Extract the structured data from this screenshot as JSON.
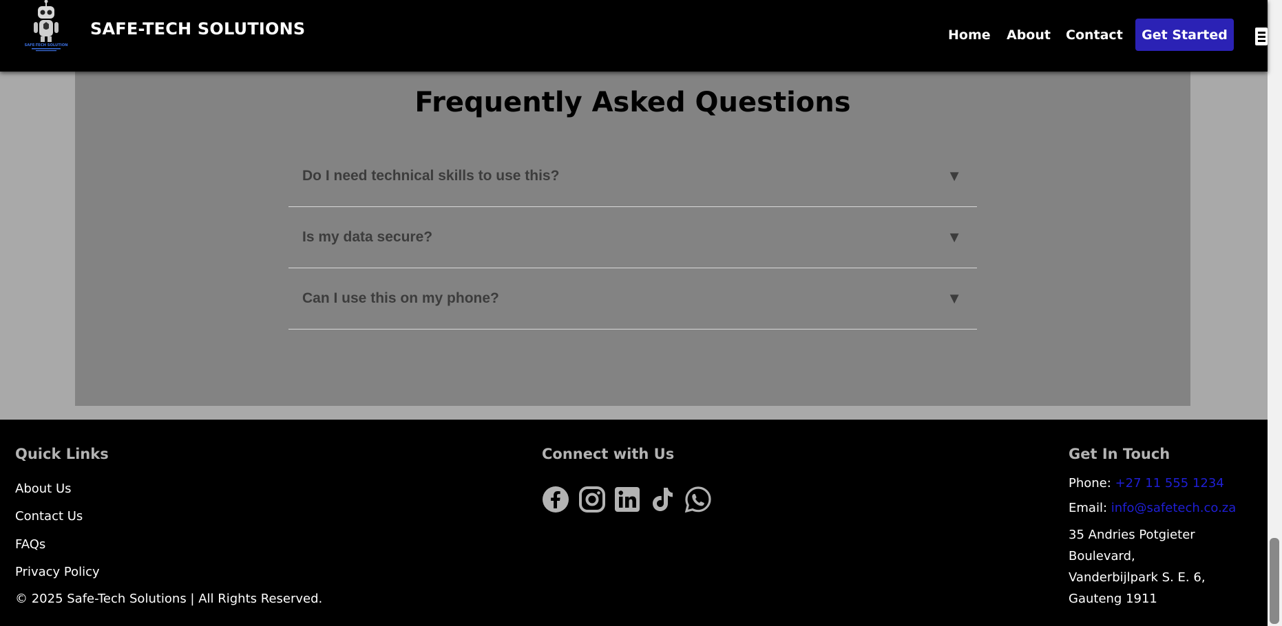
{
  "header": {
    "brand": "SAFE-TECH SOLUTIONS",
    "logo_text": "SAFE-TECH SOLUTION",
    "nav": {
      "home": "Home",
      "about": "About",
      "contact": "Contact"
    },
    "cta": "Get Started",
    "menu_icon": "hamburger-icon"
  },
  "faq": {
    "title": "Frequently Asked Questions",
    "items": [
      {
        "question": "Do I need technical skills to use this?",
        "arrow": "▼"
      },
      {
        "question": "Is my data secure?",
        "arrow": "▼"
      },
      {
        "question": "Can I use this on my phone?",
        "arrow": "▼"
      }
    ]
  },
  "footer": {
    "quick_links": {
      "heading": "Quick Links",
      "links": [
        "About Us",
        "Contact Us",
        "FAQs",
        "Privacy Policy"
      ]
    },
    "connect": {
      "heading": "Connect with Us",
      "icons": [
        "facebook-icon",
        "instagram-icon",
        "linkedin-icon",
        "tiktok-icon",
        "whatsapp-icon"
      ]
    },
    "get_in_touch": {
      "heading": "Get In Touch",
      "phone_label": "Phone:",
      "phone": "+27 11 555 1234",
      "email_label": "Email:",
      "email": "info@safetech.co.za",
      "address_lines": [
        "35 Andries Potgieter Boulevard,",
        "Vanderbijlpark S. E. 6,",
        "Gauteng 1911"
      ]
    },
    "copyright": "© 2025 Safe-Tech Solutions | All Rights Reserved."
  },
  "colors": {
    "header_bg": "#000000",
    "cta_bg": "#2b22b5",
    "faq_panel_bg": "#838383",
    "page_bg": "#a9a9a9",
    "link_blue": "#1f1fd6",
    "footer_heading": "#b3b3b3"
  }
}
